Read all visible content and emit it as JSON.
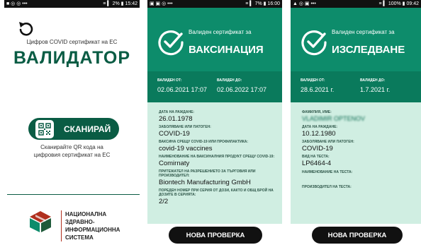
{
  "phone1": {
    "status_left": "■ ◎ ◎ •••",
    "status_right": "≡ ▍ 2% ▮ 15:42",
    "subtitle": "Цифров COVID сертификат на ЕС",
    "title": "ВАЛИДАТОР",
    "scan_label": "СКАНИРАЙ",
    "scan_hint_1": "Сканирайте QR кода на",
    "scan_hint_2": "цифровия сертификат на ЕС",
    "org_1": "НАЦИОНАЛНА",
    "org_2": "ЗДРАВНО-ИНФОРМАЦИОННА",
    "org_3": "СИСТЕМА"
  },
  "phone2": {
    "status_left": "▣ ▣ ◎ •••",
    "status_right": "≡ ▍ 7% ▮ 16:00",
    "header_small": "Валиден сертификат за",
    "header_big": "ВАКСИНАЦИЯ",
    "valid_from_label": "ВАЛИДЕН ОТ:",
    "valid_from": "02.06.2021 17:07",
    "valid_to_label": "ВАЛИДЕН ДО:",
    "valid_to": "02.06.2022 17:07",
    "fields": [
      {
        "label": "ДАТА НА РАЖДАНЕ:",
        "value": "26.01.1978"
      },
      {
        "label": "ЗАБОЛЯВАНЕ ИЛИ ПАТОГЕН:",
        "value": "COVID-19"
      },
      {
        "label": "ВАКСИНА СРЕЩУ COVID-19 ИЛИ ПРОФИЛАКТИКА:",
        "value": "covid-19 vaccines"
      },
      {
        "label": "НАИМЕНОВАНИЕ НА ВАКСИНАЛНИЯ ПРОДУКТ СРЕЩУ COVID-19:",
        "value": "Comirnaty"
      },
      {
        "label": "ПРИТЕЖАТЕЛ НА РАЗРЕШЕНИЕТО ЗА ТЪРГОВИЯ ИЛИ ПРОИЗВОДИТЕЛ:",
        "value": "Biontech Manufacturing GmbH"
      },
      {
        "label": "ПОРЕДЕН НОМЕР ПРИ СЕРИЯ ОТ ДОЗИ, КАКТО И ОБЩ БРОЙ НА ДОЗИТЕ В СЕРИЯТА:",
        "value": "2/2"
      }
    ],
    "new_check": "НОВА ПРОВЕРКА"
  },
  "phone3": {
    "status_left": "▲ ◎ ▣ •••",
    "status_right": "≡ ▍ 100% ▮ 09:42",
    "header_small": "Валиден сертификат за",
    "header_big": "ИЗСЛЕДВАНЕ",
    "valid_from_label": "ВАЛИДЕН ОТ:",
    "valid_from": "28.6.2021 г.",
    "valid_to_label": "ВАЛИДЕН ДО:",
    "valid_to": "1.7.2021 г.",
    "name_label": "ФАМИЛИЯ, ИМЕ:",
    "name_value": "VLADIMIR OPTENOV",
    "fields": [
      {
        "label": "ДАТА НА РАЖДАНЕ:",
        "value": "10.12.1980"
      },
      {
        "label": "ЗАБОЛЯВАНЕ ИЛИ ПАТОГЕН:",
        "value": "COVID-19"
      },
      {
        "label": "ВИД НА ТЕСТА:",
        "value": "LP6464-4"
      },
      {
        "label": "НАИМЕНОВАНИЕ НА ТЕСТА:",
        "value": ""
      },
      {
        "label": "ПРОИЗВОДИТЕЛ НА ТЕСТА:",
        "value": ""
      }
    ],
    "new_check": "НОВА ПРОВЕРКА"
  }
}
